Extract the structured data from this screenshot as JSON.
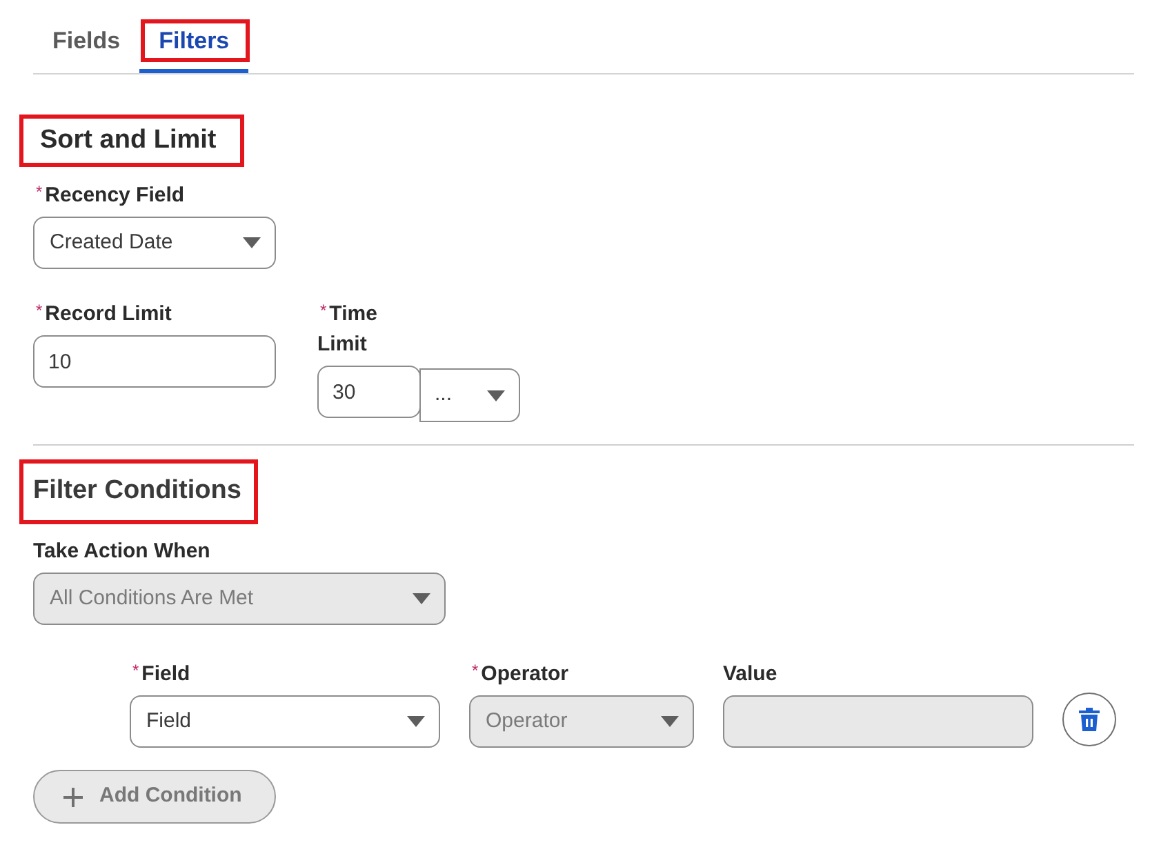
{
  "tabs": [
    {
      "label": "Fields",
      "selected": false,
      "highlighted": false
    },
    {
      "label": "Filters",
      "selected": true,
      "highlighted": true
    }
  ],
  "sort_and_limit": {
    "heading": "Sort and Limit",
    "highlighted": true,
    "recency_field": {
      "required_marker": "*",
      "label": "Recency Field",
      "value": "Created Date"
    },
    "record_limit": {
      "required_marker": "*",
      "label": "Record Limit",
      "value": "10"
    },
    "time_limit": {
      "required_marker": "*",
      "label": "Time Limit",
      "value": "30",
      "unit": "..."
    }
  },
  "filter_conditions": {
    "heading": "Filter Conditions",
    "highlighted": true,
    "take_action_when": {
      "label": "Take Action When",
      "value": "All Conditions Are Met",
      "disabled": true
    },
    "conditions": [
      {
        "field": {
          "required_marker": "*",
          "label": "Field",
          "value": "Field",
          "disabled": false
        },
        "operator": {
          "required_marker": "*",
          "label": "Operator",
          "value": "Operator",
          "disabled": true
        },
        "value": {
          "label": "Value",
          "disabled": true
        }
      }
    ],
    "add_condition": {
      "label": "Add Condition",
      "disabled": true
    }
  }
}
